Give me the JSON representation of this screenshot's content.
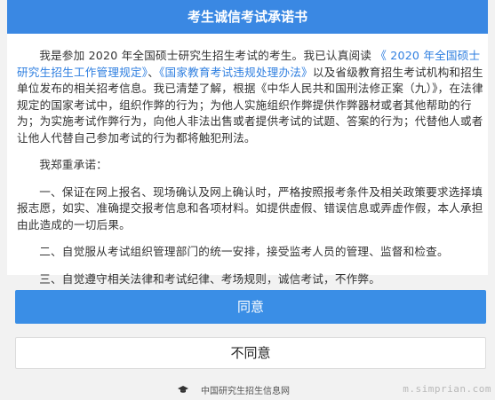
{
  "header": {
    "title": "考生诚信考试承诺书"
  },
  "body": {
    "p1": {
      "intro": "我是参加 2020 年全国硕士研究生招生考试的考生。我已认真阅读 ",
      "link1": "《 2020 年全国硕士研究生招生工作管理规定》",
      "sep": "、",
      "link2": "《国家教育考试违规处理办法》",
      "rest": "以及省级教育招生考试机构和招生单位发布的相关招考信息。我已清楚了解，根据《中华人民共和国刑法修正案（九）》，在法律规定的国家考试中，组织作弊的行为；为他人实施组织作弊提供作弊器材或者其他帮助的行为；为实施考试作弊行为，向他人非法出售或者提供考试的试题、答案的行为；代替他人或者让他人代替自己参加考试的行为都将触犯刑法。"
    },
    "p2": "我郑重承诺：",
    "p3": "一、保证在网上报名、现场确认及网上确认时，严格按照报考条件及相关政策要求选择填报志愿，如实、准确提交报考信息和各项材料。如提供虚假、错误信息或弄虚作假，本人承担由此造成的一切后果。",
    "p4": "二、自觉服从考试组织管理部门的统一安排，接受监考人员的管理、监督和检查。",
    "p5": "三、自觉遵守相关法律和考试纪律、考场规则，诚信考试，不作弊。"
  },
  "buttons": {
    "agree": "同意",
    "disagree": "不同意"
  },
  "footer": {
    "icon": "graduation-cap-icon",
    "text": "中国研究生招生信息网"
  },
  "watermark": "m.simprian.com",
  "colors": {
    "header_bg": "#3a88e3",
    "agree_bg": "#3a8ee6",
    "link": "#2f7fe0"
  }
}
